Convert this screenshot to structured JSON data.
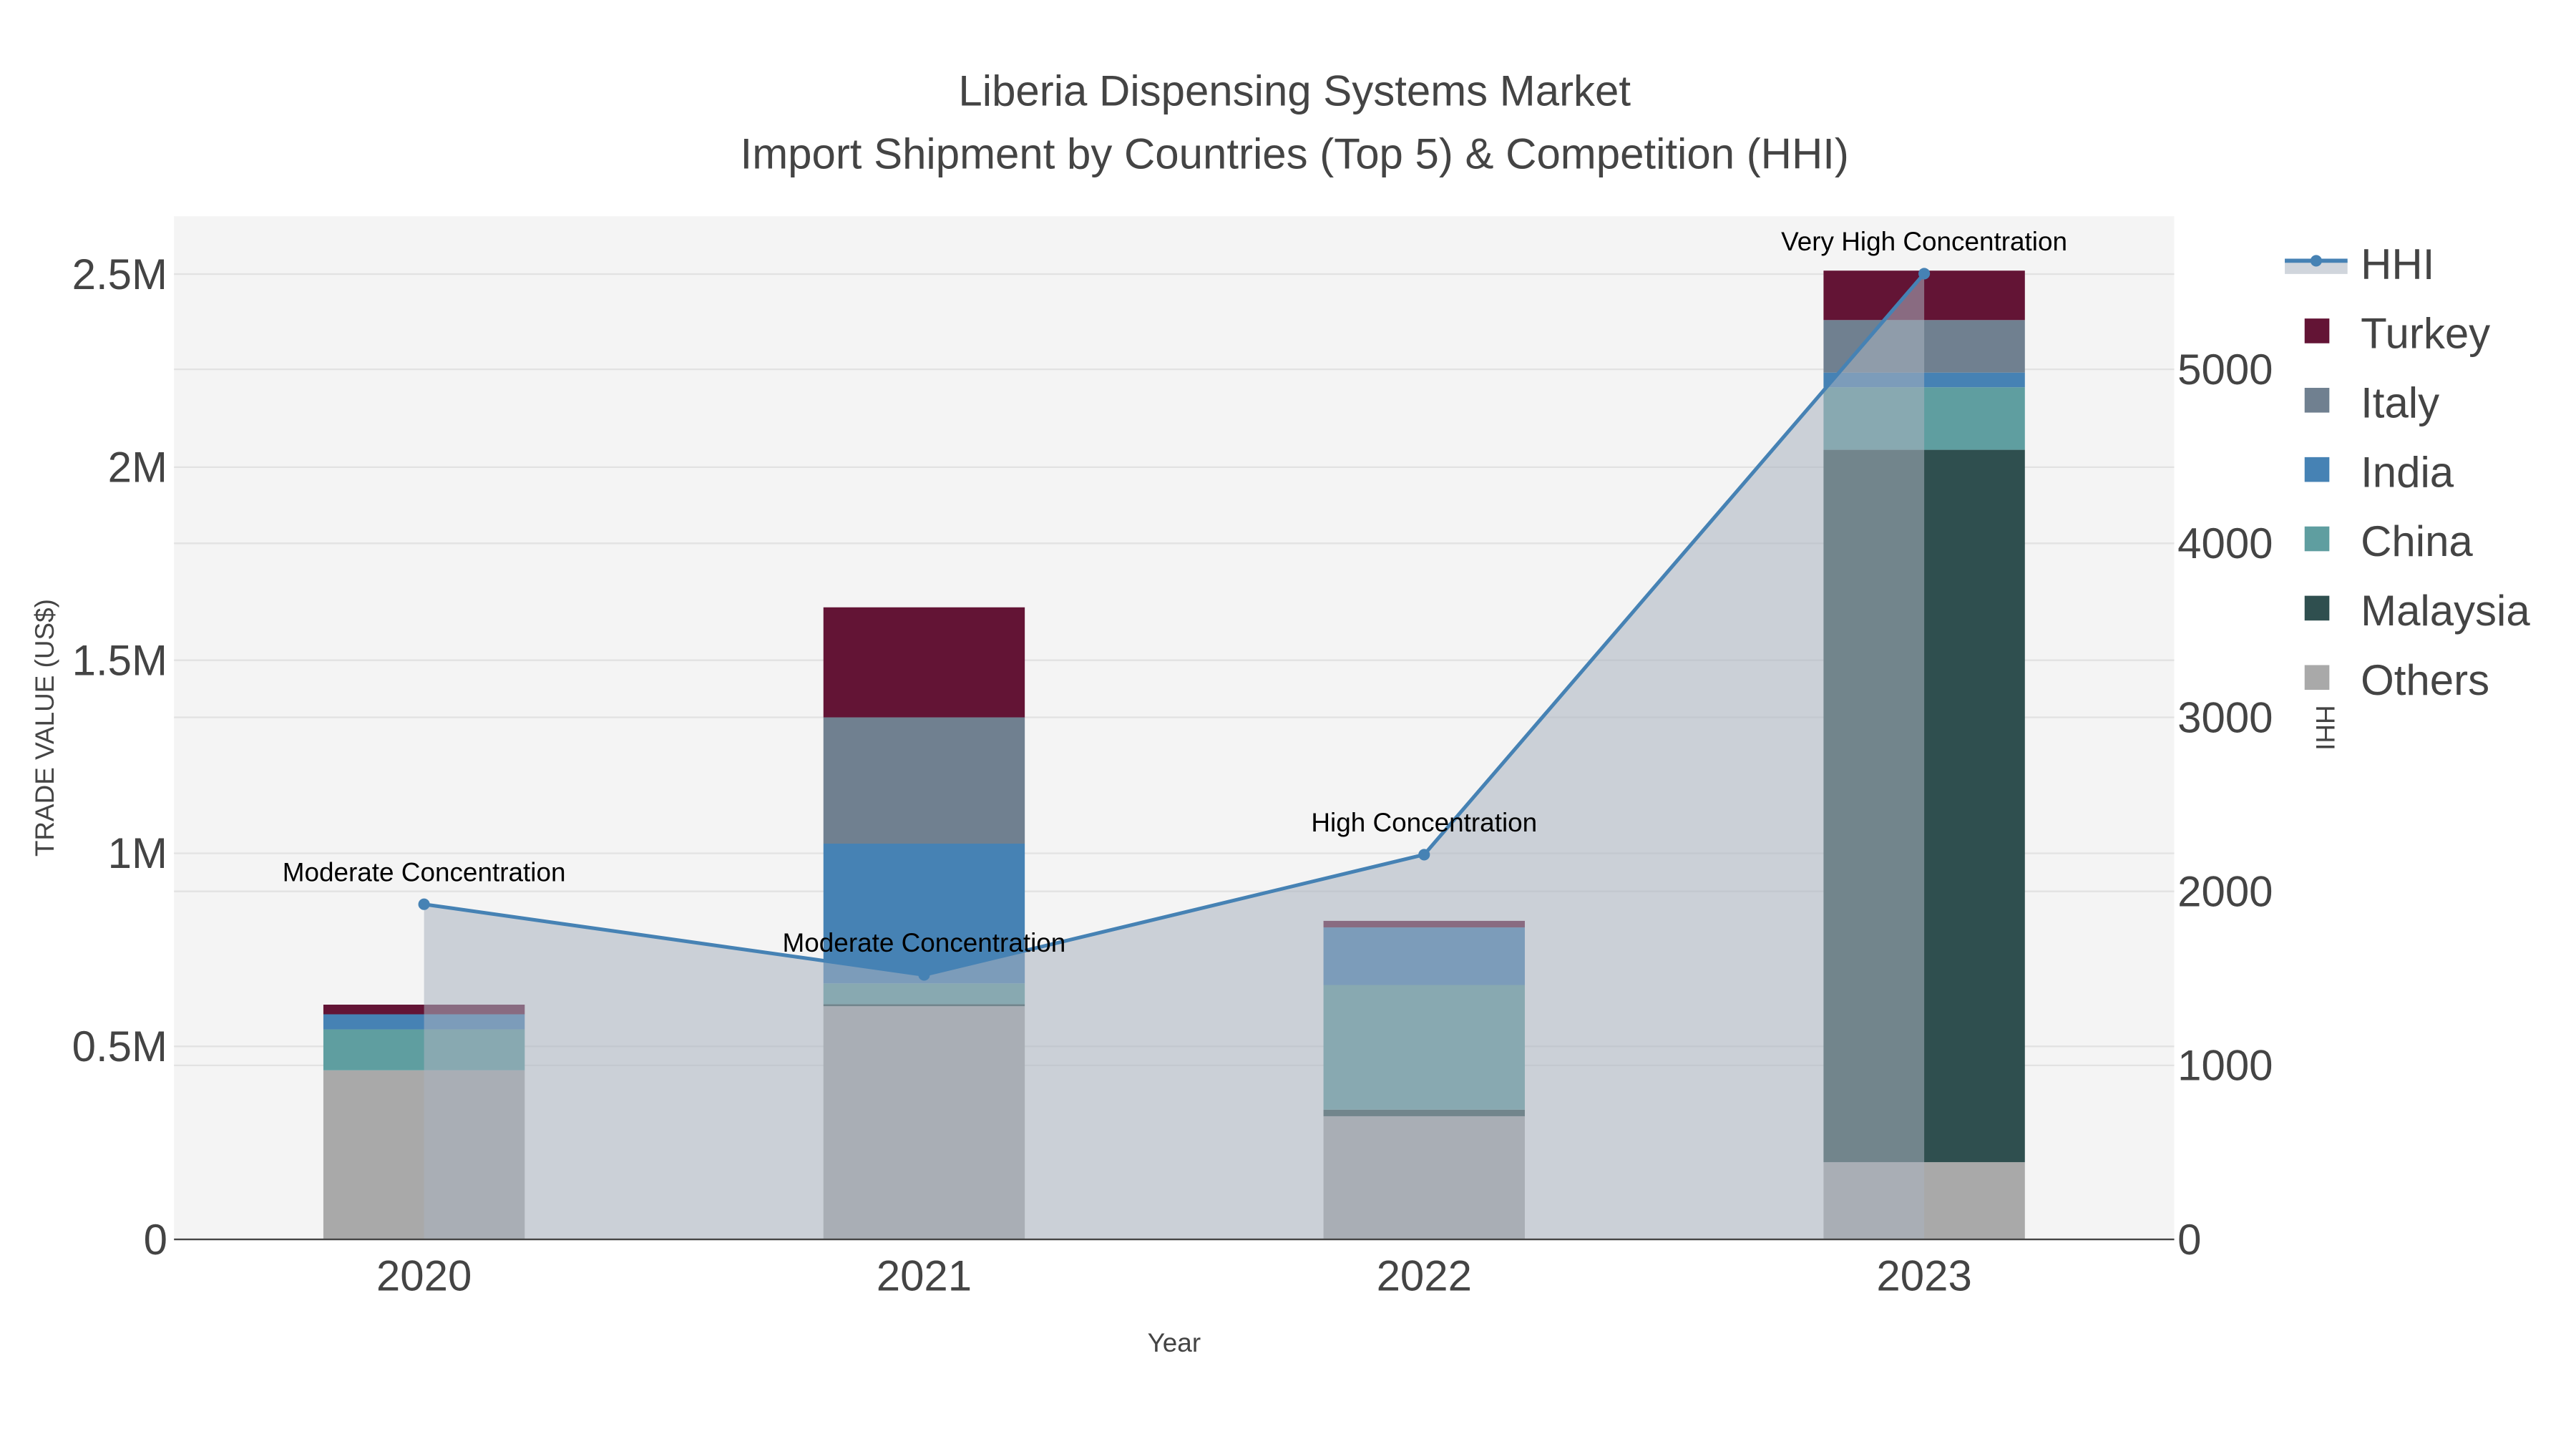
{
  "chart_data": {
    "type": "bar",
    "title_line1": "Liberia Dispensing Systems Market",
    "title_line2": "Import Shipment by Countries (Top 5) & Competition (HHI)",
    "xlabel": "Year",
    "ylabel": "TRADE VALUE (US$)",
    "y2label": "HHI",
    "categories": [
      "2020",
      "2021",
      "2022",
      "2023"
    ],
    "ylim": [
      0,
      2650000
    ],
    "y2lim": [
      0,
      5880
    ],
    "yticks": [
      {
        "v": 0,
        "label": "0"
      },
      {
        "v": 500000,
        "label": "0.5M"
      },
      {
        "v": 1000000,
        "label": "1M"
      },
      {
        "v": 1500000,
        "label": "1.5M"
      },
      {
        "v": 2000000,
        "label": "2M"
      },
      {
        "v": 2500000,
        "label": "2.5M"
      }
    ],
    "y2ticks": [
      {
        "v": 0,
        "label": "0"
      },
      {
        "v": 1000,
        "label": "1000"
      },
      {
        "v": 2000,
        "label": "2000"
      },
      {
        "v": 3000,
        "label": "3000"
      },
      {
        "v": 4000,
        "label": "4000"
      },
      {
        "v": 5000,
        "label": "5000"
      }
    ],
    "series": [
      {
        "name": "Others",
        "color": "#A9A9A9",
        "values": [
          438000,
          604000,
          319000,
          200000
        ]
      },
      {
        "name": "Malaysia",
        "color": "#2F4F4F",
        "values": [
          0,
          5000,
          17000,
          1845000
        ]
      },
      {
        "name": "China",
        "color": "#5F9EA0",
        "values": [
          106000,
          54000,
          323000,
          162000
        ]
      },
      {
        "name": "India",
        "color": "#4682B4",
        "values": [
          39000,
          362000,
          149000,
          38000
        ]
      },
      {
        "name": "Italy",
        "color": "#708090",
        "values": [
          0,
          327000,
          0,
          136000
        ]
      },
      {
        "name": "Turkey",
        "color": "#631435",
        "values": [
          25000,
          285000,
          17000,
          128000
        ]
      }
    ],
    "hhi": {
      "name": "HHI",
      "color": "#4682B4",
      "values": [
        1926,
        1520,
        2211,
        5550
      ],
      "annotations": [
        "Moderate Concentration",
        "Moderate Concentration",
        "High Concentration",
        "Very High Concentration"
      ]
    },
    "legend_order": [
      "HHI",
      "Turkey",
      "Italy",
      "India",
      "China",
      "Malaysia",
      "Others"
    ],
    "legend_position": "right",
    "grid": true
  }
}
